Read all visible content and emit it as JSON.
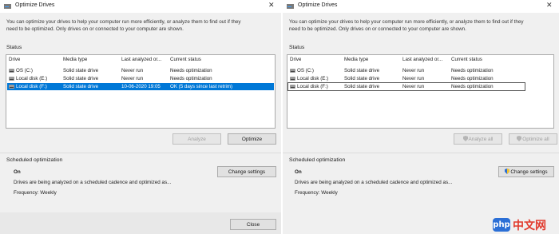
{
  "title": "Optimize Drives",
  "intro": [
    "You can optimize your drives to help your computer run more efficiently, or analyze them to find out if they",
    "need to be optimized. Only drives on or connected to your computer are shown."
  ],
  "status_label": "Status",
  "columns": [
    "Drive",
    "Media type",
    "Last analyzed or...",
    "Current status"
  ],
  "left": {
    "rows": [
      {
        "drive": "OS (C:)",
        "media": "Solid state drive",
        "last": "Never run",
        "status": "Needs optimization"
      },
      {
        "drive": "Local disk (E:)",
        "media": "Solid state drive",
        "last": "Never run",
        "status": "Needs optimization"
      },
      {
        "drive": "Local disk (F:)",
        "media": "Solid state drive",
        "last": "10-06-2020 19:05",
        "status": "OK (5 days since last retrim)"
      }
    ],
    "analyze_label": "Analyze",
    "optimize_label": "Optimize"
  },
  "right": {
    "rows": [
      {
        "drive": "OS (C:)",
        "media": "Solid state drive",
        "last": "Never run",
        "status": "Needs optimization"
      },
      {
        "drive": "Local disk (E:)",
        "media": "Solid state drive",
        "last": "Never run",
        "status": "Needs optimization"
      },
      {
        "drive": "Local disk (F:)",
        "media": "Solid state drive",
        "last": "Never run",
        "status": "Needs optimization"
      }
    ],
    "analyze_all_label": "Analyze all",
    "optimize_all_label": "Optimize all"
  },
  "scheduled": {
    "label": "Scheduled optimization",
    "state": "On",
    "description": "Drives are being analyzed on a scheduled cadence and optimized as...",
    "frequency": "Frequency: Weekly",
    "change_label": "Change settings"
  },
  "close_label": "Close",
  "watermark": {
    "badge": "php",
    "text": "中文网"
  },
  "colors": {
    "selection": "#0078d7",
    "window_bg": "#f0f0f0",
    "watermark_blue": "#2b6fd6",
    "watermark_red": "#e13a2d"
  }
}
